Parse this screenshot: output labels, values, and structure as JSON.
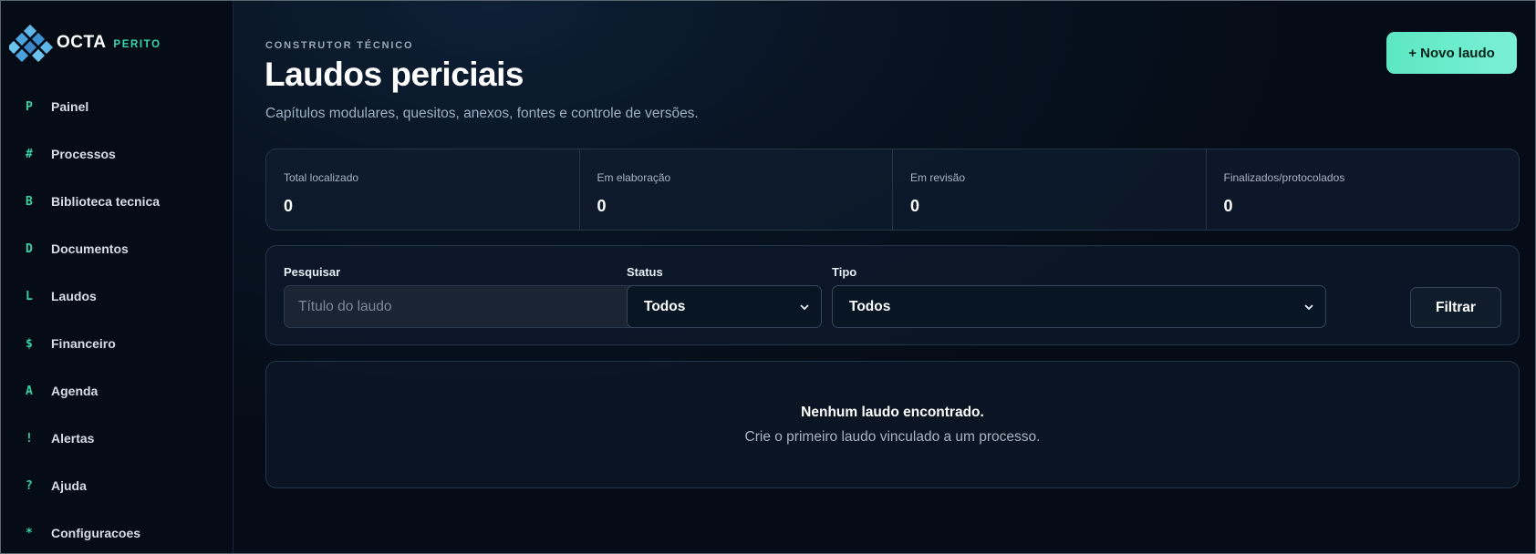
{
  "brand": {
    "name": "OCTA",
    "sub": "PERITO"
  },
  "sidebar": {
    "items": [
      {
        "glyph": "P",
        "label": "Painel"
      },
      {
        "glyph": "#",
        "label": "Processos"
      },
      {
        "glyph": "B",
        "label": "Biblioteca tecnica"
      },
      {
        "glyph": "D",
        "label": "Documentos"
      },
      {
        "glyph": "L",
        "label": "Laudos"
      },
      {
        "glyph": "$",
        "label": "Financeiro"
      },
      {
        "glyph": "A",
        "label": "Agenda"
      },
      {
        "glyph": "!",
        "label": "Alertas"
      },
      {
        "glyph": "?",
        "label": "Ajuda"
      },
      {
        "glyph": "*",
        "label": "Configuracoes"
      }
    ]
  },
  "header": {
    "eyebrow": "CONSTRUTOR TÉCNICO",
    "title": "Laudos periciais",
    "subtitle": "Capítulos modulares, quesitos, anexos, fontes e controle de versões.",
    "new_button": "+ Novo laudo"
  },
  "stats": [
    {
      "label": "Total localizado",
      "value": "0"
    },
    {
      "label": "Em elaboração",
      "value": "0"
    },
    {
      "label": "Em revisão",
      "value": "0"
    },
    {
      "label": "Finalizados/protocolados",
      "value": "0"
    }
  ],
  "filters": {
    "search_label": "Pesquisar",
    "search_placeholder": "Título do laudo",
    "search_value": "",
    "status_label": "Status",
    "status_value": "Todos",
    "tipo_label": "Tipo",
    "tipo_value": "Todos",
    "filter_button": "Filtrar"
  },
  "empty": {
    "title": "Nenhum laudo encontrado.",
    "text": "Crie o primeiro laudo vinculado a um processo."
  },
  "colors": {
    "accent": "#38d6ae",
    "button_bg": "#5ce7c1",
    "background": "#06101c"
  }
}
